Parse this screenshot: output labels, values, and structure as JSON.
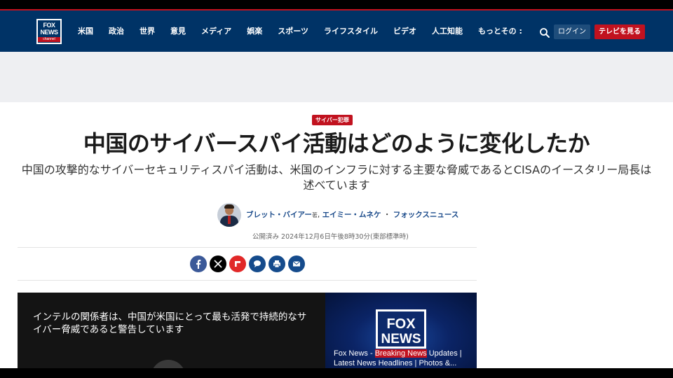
{
  "header": {
    "logo": {
      "line1": "FOX",
      "line2": "NEWS",
      "line3": "channel"
    },
    "nav": [
      "米国",
      "政治",
      "世界",
      "意見",
      "メディア",
      "娯楽",
      "スポーツ",
      "ライフスタイル",
      "ビデオ",
      "人工知能",
      "もっとその :"
    ],
    "login_label": "ログイン",
    "watch_tv_label": "テレビを見る",
    "colors": {
      "bar": "#003366",
      "accent": "#c1121f"
    }
  },
  "article": {
    "category_tag": "サイバー犯罪",
    "headline": "中国のサイバースパイ活動はどのように変化したか",
    "subheadline": "中国の攻撃的なサイバーセキュリティスパイ活動は、米国のインフラに対する主要な脅威であるとCISAのイースタリー局長は述べています",
    "authors": [
      {
        "name": "ブレット・バイアー"
      },
      {
        "name": "エイミー・ムネケ"
      },
      {
        "name": "フォックスニュース"
      }
    ],
    "author_role": "著",
    "author_sep_1": ",",
    "author_sep_2": "・",
    "published": "公開済み 2024年12月6日午後8時30分(東部標準時)",
    "share_icons": [
      "facebook-icon",
      "x-icon",
      "flipboard-icon",
      "comment-icon",
      "print-icon",
      "email-icon"
    ]
  },
  "video": {
    "caption": "インテルの関係者は、中国が米国にとって最も活発で持続的なサイバー脅威であると警告しています",
    "thumb_logo": {
      "line1": "FOX",
      "line2": "NEWS"
    },
    "thumb_title_part1": "Fox News - ",
    "thumb_title_highlight": "Breaking News",
    "thumb_title_part2": " Updates | Latest News Headlines | Photos &..."
  }
}
